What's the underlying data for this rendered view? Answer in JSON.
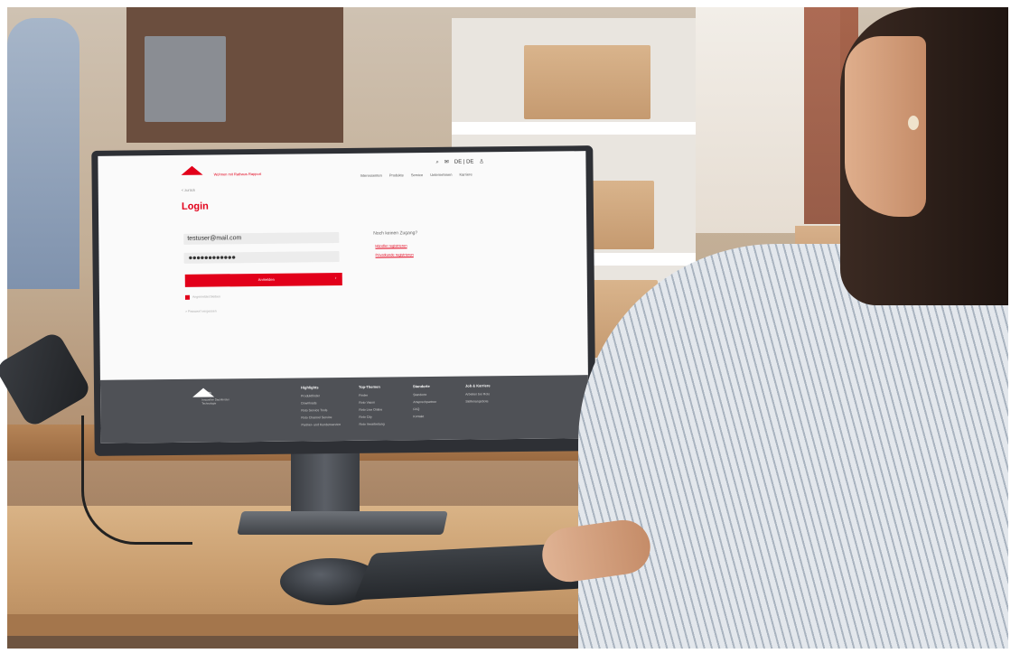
{
  "site": {
    "tagline": "Wohnen mit Rathaus Rapport",
    "back_link": "< zurück",
    "utility_icons": [
      "search-icon",
      "mail-icon",
      "flag-icon",
      "user-icon"
    ],
    "utility_text": "DE | DE",
    "nav": [
      "Interessenten",
      "Produkte",
      "Service",
      "Unternehmen",
      "Karriere"
    ],
    "login_title": "Login",
    "email_value": "testuser@mail.com",
    "password_mask": "●●●●●●●●●●●●",
    "submit_label": "Anmelden",
    "submit_arrow": "›",
    "remember_label": "Angemeldet bleiben",
    "forgot_label": "> Passwort vergessen",
    "side_title": "Noch keinen Zugang?",
    "side_links": [
      "Händler registrieren",
      "Privatkunde registrieren"
    ],
    "accent_color": "#e2001a"
  },
  "footer": {
    "brand": "Roto",
    "tagline": "Innovative Dachfenster Technologie",
    "columns": [
      {
        "head": "Highlights",
        "items": [
          "Produktfinder",
          "Downloads",
          "Roto Service Tools",
          "Roto Channel Service",
          "Partner- und Kundenservice"
        ]
      },
      {
        "head": "Top-Themen",
        "items": [
          "Finder",
          "Roto Vision",
          "Roto Live Online",
          "Roto City",
          "Roto Verarbeitung"
        ]
      },
      {
        "head": "Standorte",
        "items": [
          "Standorte",
          "Ansprechpartner",
          "FAQ",
          "Kontakt"
        ]
      },
      {
        "head": "Job & Karriere",
        "items": [
          "Arbeiten bei Roto",
          "Stellenangebote"
        ]
      }
    ]
  }
}
